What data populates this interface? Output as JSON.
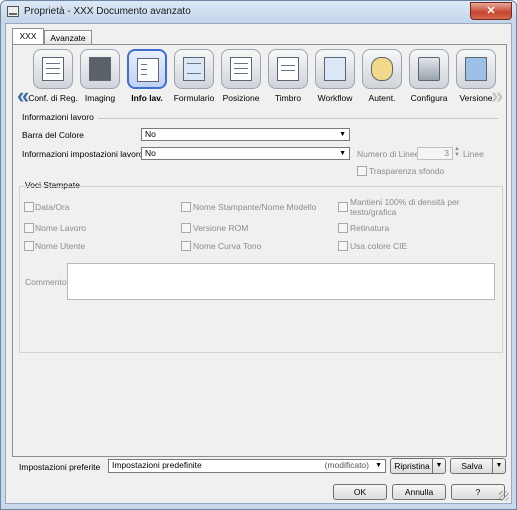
{
  "window": {
    "title": "Proprietà - XXX Documento avanzato",
    "close_label": "✕"
  },
  "tabs": [
    {
      "label": "XXX",
      "active": true
    },
    {
      "label": "Avanzate",
      "active": false
    }
  ],
  "toolbar": {
    "items": [
      {
        "label": "Conf. di Reg.",
        "icon": "registration-settings-icon"
      },
      {
        "label": "Imaging",
        "icon": "imaging-icon"
      },
      {
        "label": "Info lav.",
        "icon": "job-info-icon",
        "selected": true
      },
      {
        "label": "Formulario",
        "icon": "form-icon"
      },
      {
        "label": "Posizione",
        "icon": "position-icon"
      },
      {
        "label": "Timbro",
        "icon": "stamp-icon"
      },
      {
        "label": "Workflow",
        "icon": "workflow-icon"
      },
      {
        "label": "Autent.",
        "icon": "authentication-icon"
      },
      {
        "label": "Configura",
        "icon": "configure-icon"
      },
      {
        "label": "Versione",
        "icon": "version-icon"
      }
    ],
    "prev_arrow": "«",
    "next_arrow": "»"
  },
  "job_info": {
    "section_title": "Informazioni lavoro",
    "color_bar": {
      "label": "Barra del Colore",
      "value": "No"
    },
    "job_settings_info": {
      "label": "Informazioni impostazioni lavoro",
      "value": "No"
    },
    "lines_count": {
      "label": "Numero di Linee",
      "value": "3",
      "unit": "Linee"
    },
    "background_transparency": {
      "label": "Trasparenza sfondo",
      "checked": false
    }
  },
  "print_items": {
    "section_title": "Voci Stampate",
    "checkboxes": [
      {
        "label": "Data/Ora",
        "checked": false
      },
      {
        "label": "Nome Stampante/Nome Modello",
        "checked": false
      },
      {
        "label": "Mantieni 100% di densità per",
        "label2": "testo/grafica",
        "checked": false
      },
      {
        "label": "Nome Lavoro",
        "checked": false
      },
      {
        "label": "Versione ROM",
        "checked": false
      },
      {
        "label": "Retinatura",
        "checked": false
      },
      {
        "label": "Nome Utente",
        "checked": false
      },
      {
        "label": "Nome Curva Tono",
        "checked": false
      },
      {
        "label": "Usa colore CIE",
        "checked": false
      }
    ],
    "comment_label": "Commento",
    "comment_value": ""
  },
  "favorites": {
    "label": "Impostazioni preferite",
    "value": "Impostazioni predefinite",
    "status": "(modificato)",
    "restore_label": "Ripristina",
    "save_label": "Salva"
  },
  "footer": {
    "ok_label": "OK",
    "cancel_label": "Annulla",
    "help_label": "?"
  }
}
